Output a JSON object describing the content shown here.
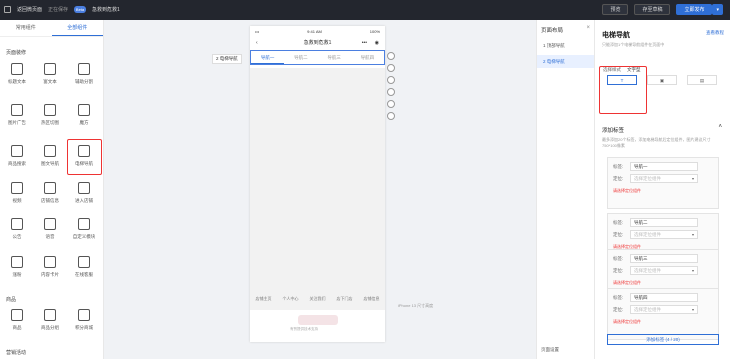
{
  "topbar": {
    "back_label": "返回微页面",
    "saving_label": "正在保存",
    "logo_text": "Beta",
    "page_title": "急救到危救1",
    "preview_label": "预览",
    "save_draft_label": "存至草稿",
    "publish_label": "立即发布",
    "dropdown_arrow": "▾"
  },
  "left_panel": {
    "tabs": [
      "常用组件",
      "全部组件"
    ],
    "section_page": "页面装修",
    "section_goods": "商品",
    "section_marketing": "营销活动",
    "components": [
      {
        "label": "标题文本",
        "icon": "title-text-icon"
      },
      {
        "label": "富文本",
        "icon": "rich-text-icon"
      },
      {
        "label": "辅助分割",
        "icon": "divider-icon"
      },
      {
        "label": "图片广告",
        "icon": "image-ad-icon"
      },
      {
        "label": "热区切图",
        "icon": "hotspot-icon"
      },
      {
        "label": "魔方",
        "icon": "cube-icon"
      },
      {
        "label": "商品搜索",
        "icon": "search-icon"
      },
      {
        "label": "图文导航",
        "icon": "image-nav-icon"
      },
      {
        "label": "电梯导航",
        "icon": "elevator-nav-icon"
      },
      {
        "label": "视频",
        "icon": "video-icon"
      },
      {
        "label": "店铺信息",
        "icon": "store-icon"
      },
      {
        "label": "进入店铺",
        "icon": "enter-store-icon"
      },
      {
        "label": "公告",
        "icon": "notice-icon"
      },
      {
        "label": "语音",
        "icon": "voice-icon"
      },
      {
        "label": "自定义模块",
        "icon": "custom-module-icon"
      },
      {
        "label": "涨粉",
        "icon": "fans-icon"
      },
      {
        "label": "内容卡片",
        "icon": "content-card-icon"
      },
      {
        "label": "在线客服",
        "icon": "service-icon"
      },
      {
        "label": "商品",
        "icon": "goods-icon"
      },
      {
        "label": "商品分组",
        "icon": "goods-group-icon"
      },
      {
        "label": "积分商城",
        "icon": "points-mall-icon"
      }
    ]
  },
  "canvas": {
    "status_time": "9:41 AM",
    "status_signal": "•••",
    "status_battery": "100%",
    "phone_title": "急救到危救1",
    "nav_tabs": [
      "导航一",
      "导航二",
      "导航三",
      "导航四"
    ],
    "nav_label": "2 电梯导航",
    "footer_links": [
      "店铺主页",
      "个人中心",
      "关注我们",
      "店下门店",
      "店铺信息"
    ],
    "footer_tagline": "有赞提供技术支持",
    "iphone_label": "iPhone 13 尺寸高度"
  },
  "layout_panel": {
    "title": "页面布局",
    "close": "×",
    "items": [
      "1 顶部导航",
      "2 电梯导航"
    ],
    "settings_label": "页面设置"
  },
  "props": {
    "title": "电梯导航",
    "help_link": "查看教程",
    "desc": "只能添加1个电梯导航组件在页面中",
    "style_label": "选择样式",
    "style_value": "文字型",
    "style_options": [
      "T",
      "▣",
      "▤"
    ],
    "add_title": "添加标签",
    "add_desc": "最多添加20个标签，添加电梯导航后定位组件，图片建议尺寸750*100像素",
    "label_key": "标签:",
    "locate_key": "定位:",
    "locate_placeholder": "选择定位组件",
    "error_text": "请选择定位组件",
    "tabs": [
      "导航一",
      "导航二",
      "导航三",
      "导航四"
    ],
    "add_button": "添加标签 (4 / 20)"
  }
}
